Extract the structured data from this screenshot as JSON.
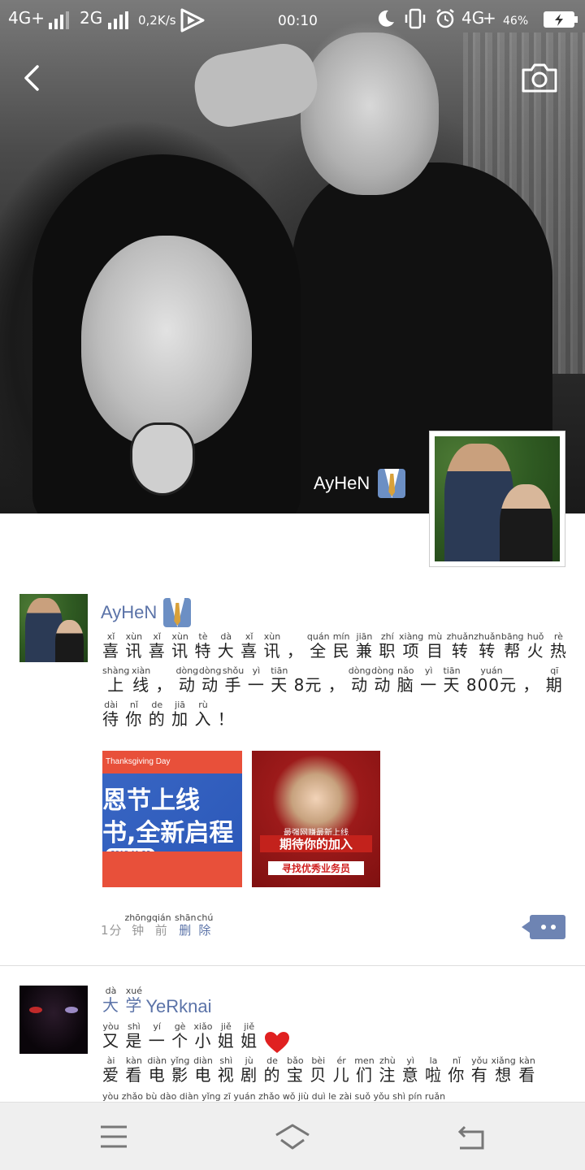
{
  "status_bar": {
    "net1": "4G+",
    "net2": "2G",
    "speed": "0,2K/s",
    "time": "00:10",
    "net3": "4G",
    "battery": "46%"
  },
  "cover": {
    "username": "AyHeN"
  },
  "posts": [
    {
      "author": "AyHeN",
      "lines": [
        [
          [
            "喜",
            "xǐ"
          ],
          [
            "讯",
            "xùn"
          ],
          [
            "喜",
            "xǐ"
          ],
          [
            "讯",
            "xùn"
          ],
          [
            "特",
            "tè"
          ],
          [
            "大",
            "dà"
          ],
          [
            "喜",
            "xǐ"
          ],
          [
            "讯",
            "xùn"
          ],
          [
            "，",
            ""
          ],
          [
            "全",
            "quán"
          ],
          [
            "民",
            "mín"
          ],
          [
            "兼",
            "jiān"
          ],
          [
            "职",
            "zhí"
          ],
          [
            "项",
            "xiàng"
          ],
          [
            "目",
            "mù"
          ],
          [
            "转",
            "zhuǎn"
          ],
          [
            "转",
            "zhuǎn"
          ],
          [
            "帮",
            "bāng"
          ],
          [
            "火",
            "huǒ"
          ],
          [
            "热",
            "rè"
          ]
        ],
        [
          [
            "上",
            "shàng"
          ],
          [
            "线",
            "xiàn"
          ],
          [
            "，",
            ""
          ],
          [
            "动",
            "dòng"
          ],
          [
            "动",
            "dòng"
          ],
          [
            "手",
            "shǒu"
          ],
          [
            "一",
            "yì"
          ],
          [
            "天",
            "tiān"
          ],
          [
            "8元",
            ""
          ],
          [
            "，",
            ""
          ],
          [
            "动",
            "dòng"
          ],
          [
            "动",
            "dòng"
          ],
          [
            "脑",
            "nǎo"
          ],
          [
            "一",
            "yì"
          ],
          [
            "天",
            "tiān"
          ],
          [
            "800元",
            "yuán"
          ],
          [
            "，",
            ""
          ],
          [
            "期",
            "qī"
          ]
        ],
        [
          [
            "待",
            "dài"
          ],
          [
            "你",
            "nǐ"
          ],
          [
            "的",
            "de"
          ],
          [
            "加",
            "jiā"
          ],
          [
            "入",
            "rù"
          ],
          [
            "！",
            ""
          ]
        ]
      ],
      "images": [
        {
          "band": "Thanksgiving Day",
          "line1": "恩节上线",
          "line2": "书,全新启程",
          "date": "2018.11.22"
        },
        {
          "sub": "最强网赚最新上线",
          "headline": "期待你的加入",
          "tag": "寻找优秀业务员"
        }
      ],
      "time_ago": [
        [
          "1分",
          ""
        ],
        [
          "钟",
          "zhōng"
        ],
        [
          "前",
          "qián"
        ]
      ],
      "delete_label": [
        [
          "删",
          "shān"
        ],
        [
          "除",
          "chú"
        ]
      ]
    },
    {
      "author_prefix": [
        [
          "大",
          "dà"
        ],
        [
          "学",
          "xué"
        ]
      ],
      "author": "YeRknai",
      "lines": [
        [
          [
            "又",
            "yòu"
          ],
          [
            "是",
            "shì"
          ],
          [
            "一",
            "yí"
          ],
          [
            "个",
            "gè"
          ],
          [
            "小",
            "xiǎo"
          ],
          [
            "姐",
            "jiě"
          ],
          [
            "姐",
            "jiě"
          ]
        ],
        [
          [
            "爱",
            "ài"
          ],
          [
            "看",
            "kàn"
          ],
          [
            "电",
            "diàn"
          ],
          [
            "影",
            "yǐng"
          ],
          [
            "电",
            "diàn"
          ],
          [
            "视",
            "shì"
          ],
          [
            "剧",
            "jù"
          ],
          [
            "的",
            "de"
          ],
          [
            "宝",
            "bǎo"
          ],
          [
            "贝",
            "bèi"
          ],
          [
            "儿",
            "ér"
          ],
          [
            "们",
            "men"
          ],
          [
            "注",
            "zhù"
          ],
          [
            "意",
            "yì"
          ],
          [
            "啦",
            "la"
          ],
          [
            "你",
            "nǐ"
          ],
          [
            "有",
            "yǒu"
          ],
          [
            "想",
            "xiǎng"
          ],
          [
            "看",
            "kàn"
          ]
        ],
        [
          [
            "",
            ""
          ],
          [
            "",
            "yòu zhǎo bù dào diàn yǐng zī yuán zhǎo wǒ jiù duì le zài suǒ yǒu shì pín ruǎn"
          ]
        ]
      ]
    }
  ],
  "colors": {
    "accent": "#5b73a8",
    "nav_bg": "#efefef"
  }
}
